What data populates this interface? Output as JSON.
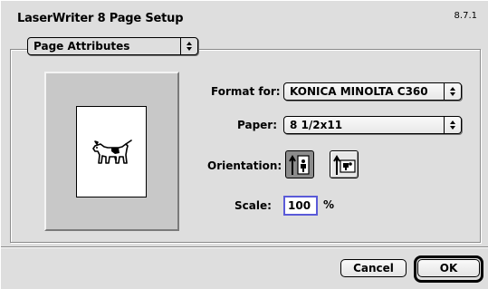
{
  "window": {
    "title": "LaserWriter 8 Page Setup",
    "version": "8.7.1"
  },
  "section_popup": {
    "value": "Page Attributes"
  },
  "preview": {
    "icon": "dogcow-icon"
  },
  "format_for": {
    "label": "Format for:",
    "value": "KONICA MINOLTA C360"
  },
  "paper": {
    "label": "Paper:",
    "value": "8 1/2x11"
  },
  "orientation": {
    "label": "Orientation:",
    "options": [
      {
        "name": "portrait",
        "selected": true
      },
      {
        "name": "landscape",
        "selected": false
      }
    ]
  },
  "scale": {
    "label": "Scale:",
    "value": "100",
    "unit": "%"
  },
  "buttons": {
    "cancel": "Cancel",
    "ok": "OK"
  },
  "colors": {
    "focus": "#5a5ad8",
    "background": "#dedede",
    "selected": "#8c8c8c"
  }
}
